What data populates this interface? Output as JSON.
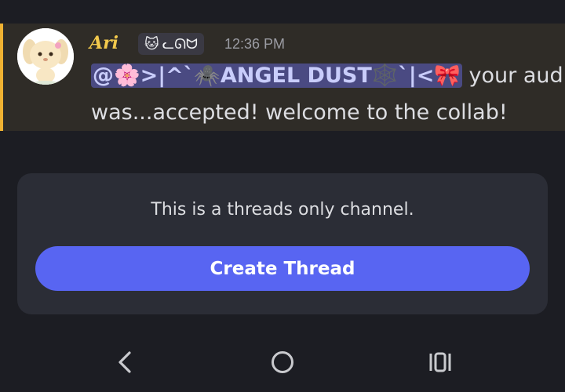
{
  "message": {
    "username": "Ari",
    "badge_emoji": "🐱",
    "badge_text": "ᓚᘏᗢ",
    "timestamp": "12:36 PM",
    "mention_text": "@🌸>|^`🕷️ANGEL DUST🕸️`|<🎀",
    "text_after_mention": " your aud",
    "line2": "was...accepted! welcome to the collab!"
  },
  "threads_card": {
    "notice": "This is a threads only channel.",
    "create_label": "Create Thread"
  },
  "colors": {
    "accent": "#5865f2",
    "highlight_bar": "#f0b232",
    "username": "#f2c94c",
    "mention_bg": "#4a4a82"
  },
  "nav": {
    "back_icon": "back-icon",
    "home_icon": "home-icon",
    "recents_icon": "recents-icon"
  }
}
